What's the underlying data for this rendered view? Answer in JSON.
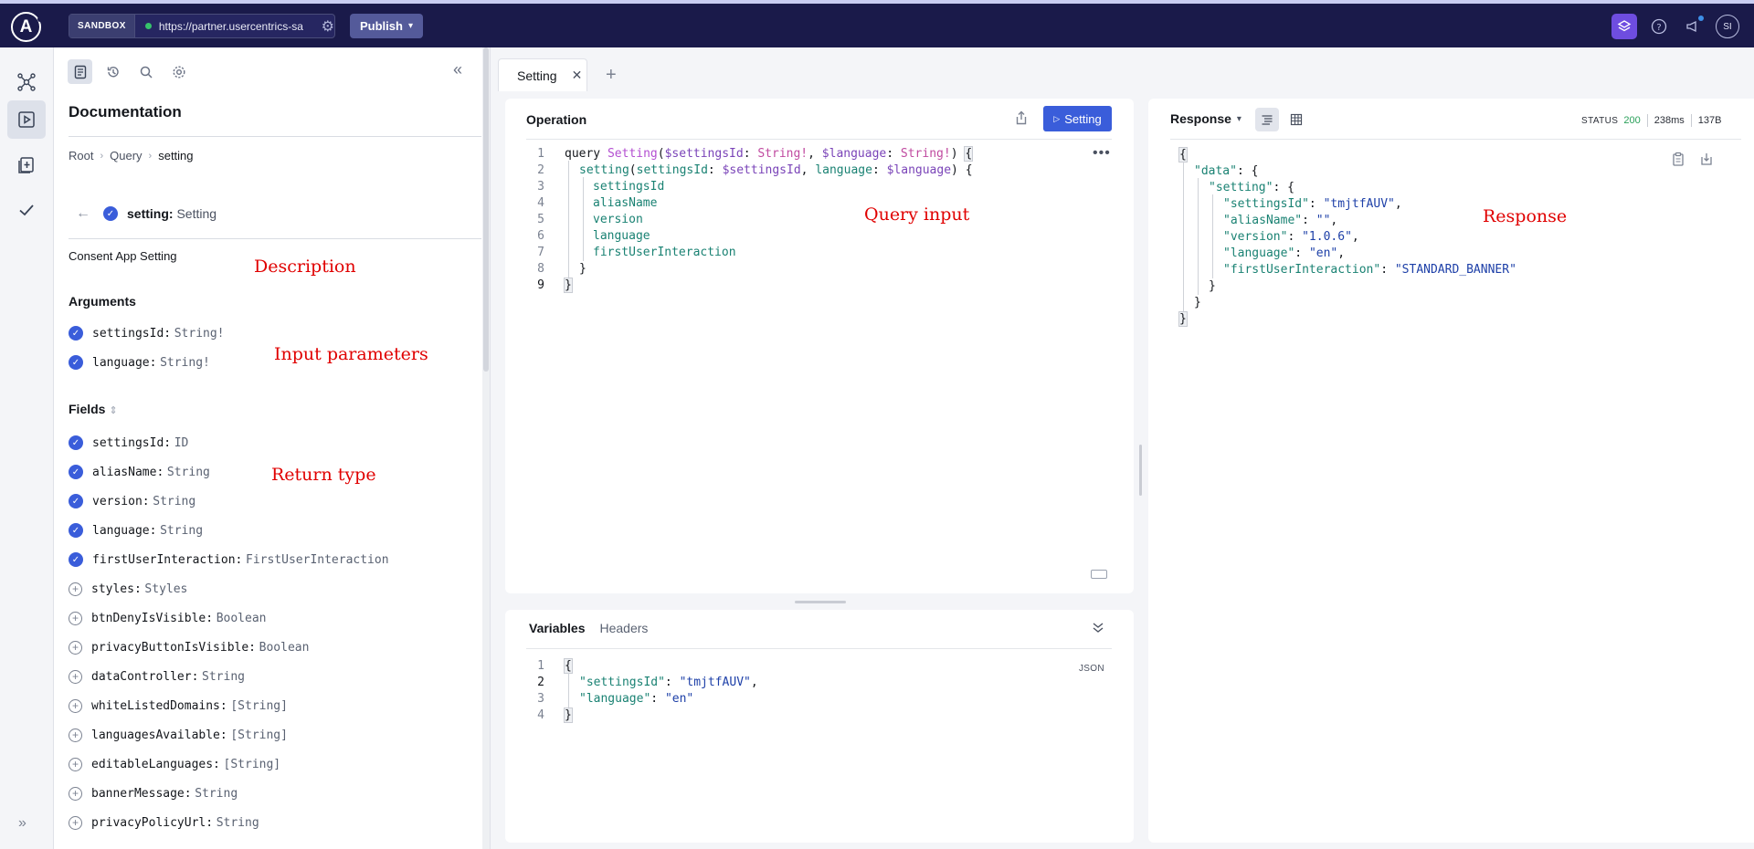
{
  "topbar": {
    "logo_letter": "A",
    "env_tag": "SANDBOX",
    "endpoint_url": "https://partner.usercentrics-sa",
    "publish_label": "Publish",
    "avatar_initials": "SI"
  },
  "docs": {
    "title": "Documentation",
    "breadcrumb": [
      "Root",
      "Query",
      "setting"
    ],
    "field_name": "setting:",
    "field_type": "Setting",
    "description": "Consent App Setting",
    "arguments_title": "Arguments",
    "arguments": [
      {
        "name": "settingsId:",
        "type": "String!"
      },
      {
        "name": "language:",
        "type": "String!"
      }
    ],
    "fields_title": "Fields",
    "fields": [
      {
        "name": "settingsId:",
        "type": "ID",
        "selected": true
      },
      {
        "name": "aliasName:",
        "type": "String",
        "selected": true
      },
      {
        "name": "version:",
        "type": "String",
        "selected": true
      },
      {
        "name": "language:",
        "type": "String",
        "selected": true
      },
      {
        "name": "firstUserInteraction:",
        "type": "FirstUserInteraction",
        "selected": true
      },
      {
        "name": "styles:",
        "type": "Styles",
        "selected": false
      },
      {
        "name": "btnDenyIsVisible:",
        "type": "Boolean",
        "selected": false
      },
      {
        "name": "privacyButtonIsVisible:",
        "type": "Boolean",
        "selected": false
      },
      {
        "name": "dataController:",
        "type": "String",
        "selected": false
      },
      {
        "name": "whiteListedDomains:",
        "type": "[String]",
        "selected": false
      },
      {
        "name": "languagesAvailable:",
        "type": "[String]",
        "selected": false
      },
      {
        "name": "editableLanguages:",
        "type": "[String]",
        "selected": false
      },
      {
        "name": "bannerMessage:",
        "type": "String",
        "selected": false
      },
      {
        "name": "privacyPolicyUrl:",
        "type": "String",
        "selected": false
      }
    ]
  },
  "annotations": {
    "description": "Description",
    "input_parameters": "Input parameters",
    "return_type": "Return type",
    "query_input": "Query input",
    "response": "Response"
  },
  "tabs": [
    {
      "label": "Setting"
    }
  ],
  "operation": {
    "title": "Operation",
    "run_label": "Setting",
    "line_numbers": [
      "1",
      "2",
      "3",
      "4",
      "5",
      "6",
      "7",
      "8",
      "9"
    ]
  },
  "variables": {
    "tab_variables": "Variables",
    "tab_headers": "Headers",
    "format": "JSON",
    "line_numbers": [
      "1",
      "2",
      "3",
      "4"
    ]
  },
  "response": {
    "title": "Response",
    "status_label": "STATUS",
    "status_code": "200",
    "time": "238ms",
    "size": "137B"
  }
}
